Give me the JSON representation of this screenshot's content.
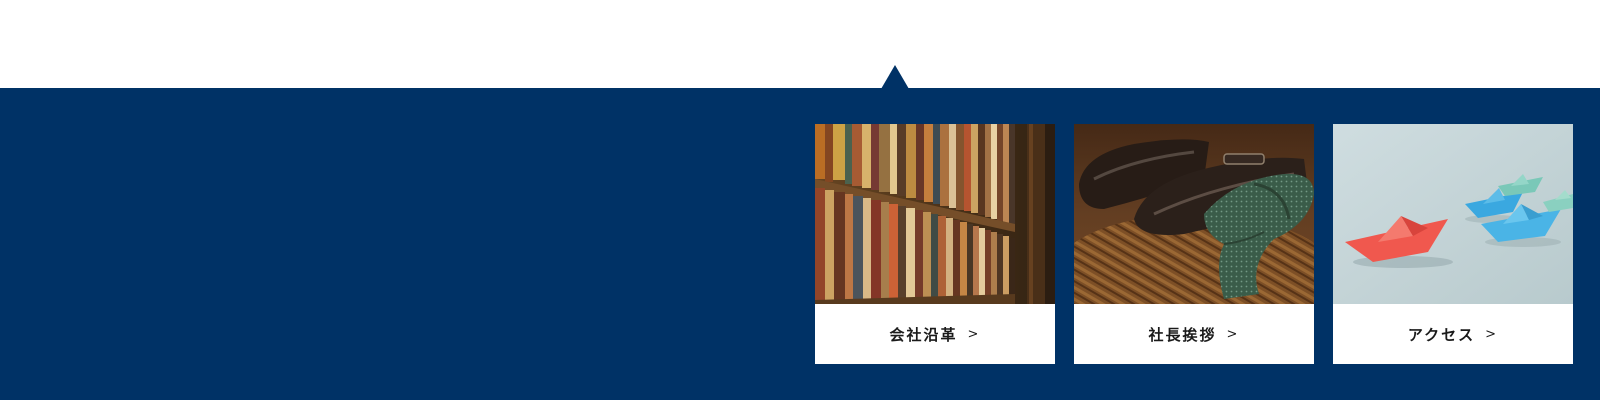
{
  "theme": {
    "panel_color": "#003266",
    "card_background": "#ffffff"
  },
  "cards": [
    {
      "label": "会社沿革",
      "arrow": ">",
      "image": "bookshelf-photo"
    },
    {
      "label": "社長挨拶",
      "arrow": ">",
      "image": "leather-shoes-and-tie-photo"
    },
    {
      "label": "アクセス",
      "arrow": ">",
      "image": "paper-boats-photo"
    }
  ]
}
